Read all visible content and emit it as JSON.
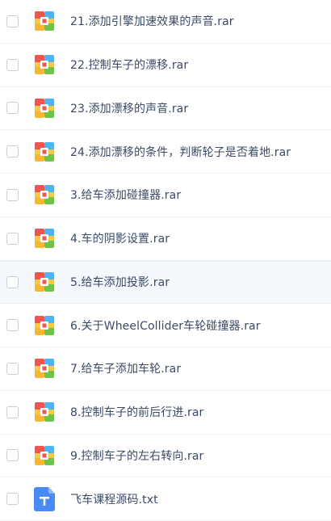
{
  "files": [
    {
      "name": "21.添加引擎加速效果的声音.rar",
      "type": "rar",
      "icon": "archive-icon"
    },
    {
      "name": "22.控制车子的漂移.rar",
      "type": "rar",
      "icon": "archive-icon"
    },
    {
      "name": "23.添加漂移的声音.rar",
      "type": "rar",
      "icon": "archive-icon"
    },
    {
      "name": "24.添加漂移的条件，判断轮子是否着地.rar",
      "type": "rar",
      "icon": "archive-icon"
    },
    {
      "name": "3.给车添加碰撞器.rar",
      "type": "rar",
      "icon": "archive-icon"
    },
    {
      "name": "4.车的阴影设置.rar",
      "type": "rar",
      "icon": "archive-icon"
    },
    {
      "name": "5.给车添加投影.rar",
      "type": "rar",
      "icon": "archive-icon"
    },
    {
      "name": "6.关于WheelCollider车轮碰撞器.rar",
      "type": "rar",
      "icon": "archive-icon"
    },
    {
      "name": "7.给车子添加车轮.rar",
      "type": "rar",
      "icon": "archive-icon"
    },
    {
      "name": "8.控制车子的前后行进.rar",
      "type": "rar",
      "icon": "archive-icon"
    },
    {
      "name": "9.控制车子的左右转向.rar",
      "type": "rar",
      "icon": "archive-icon"
    },
    {
      "name": "飞车课程源码.txt",
      "type": "txt",
      "icon": "text-file-icon"
    }
  ],
  "colors": {
    "text": "#3b4a66",
    "hover_row": "#f5f8fc",
    "txt_icon": "#4a8af4"
  }
}
